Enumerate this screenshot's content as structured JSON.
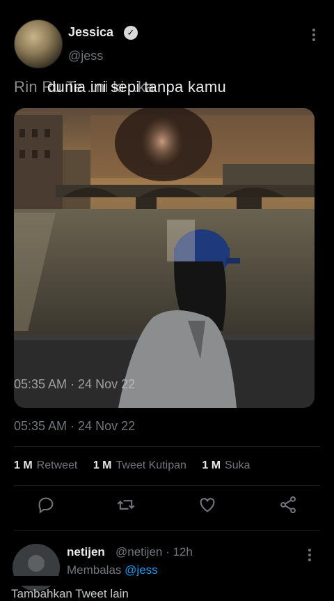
{
  "tweet": {
    "author_name": "Jessica",
    "author_handle": "@jess",
    "text": "dunia ini sepi tanpa kamu",
    "ghost_text": "Rin Ru Te ..ni ki ..ka",
    "timestamp": "05:35 AM · 24 Nov 22",
    "ghost_timestamp": "05:35 AM · 24 Nov 22"
  },
  "stats": [
    {
      "count": "1 M",
      "label": "Retweet"
    },
    {
      "count": "1 M",
      "label": "Tweet Kutipan"
    },
    {
      "count": "1 M",
      "label": "Suka"
    }
  ],
  "icons": {
    "verified": "verified-badge-icon",
    "more": "more-vertical-icon",
    "reply": "comment-icon",
    "retweet": "retweet-icon",
    "like": "heart-icon",
    "share": "share-icon"
  },
  "reply": {
    "name": "netijen",
    "meta": "@netijen · 12h",
    "replying_prefix": "Membalas",
    "replying_to": "@jess"
  },
  "footer": {
    "text": "Tambahkan Tweet lain"
  },
  "colors": {
    "background": "#000000",
    "text_primary": "#e7e9ea",
    "text_secondary": "#71767b",
    "link": "#1d9bf0"
  }
}
